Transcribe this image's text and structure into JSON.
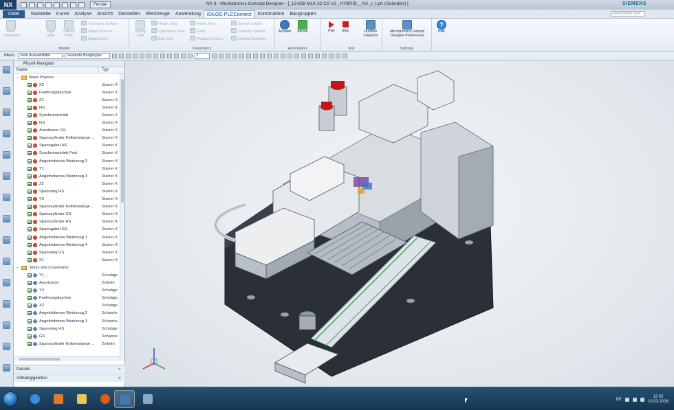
{
  "app": {
    "logo": "NX",
    "window_title": "NX 9 - Mechatronics Concept Designer - [_13-828 MLK 32 CS V2 _HYBRID__NX_v_t.prt (Geändert) ]",
    "fenster_label": "Fenster",
    "brand": "SIEMENS",
    "command_search_placeholder": "Einen Befehl such"
  },
  "ribbon_tabs": [
    "Datei",
    "Startseite",
    "Kurve",
    "Analyse",
    "Ansicht",
    "Darstellen",
    "Werkzeuge",
    "Anwendung",
    "iSILOG PLCConnect",
    "Konstruktion",
    "Baugruppen"
  ],
  "active_tab": "iSILOG PLCConnect",
  "ribbon": {
    "modell": {
      "label": "Modell",
      "buttons": [
        "Move Component",
        "Rigid Body",
        "Collision Body",
        "Sliding Joint"
      ],
      "small": [
        "Transport Surface",
        "Object Source",
        "Object Sink"
      ]
    },
    "kinematics": {
      "label": "Kinematics",
      "small": [
        "Hinge Joint",
        "Cylindrical Joint",
        "Ball Joint",
        "Fixed Joint",
        "Gear",
        "Position Control",
        "Speed Control",
        "Collision Sensor",
        "Limited Switches"
      ]
    },
    "automation": {
      "label": "Automation",
      "buttons": [
        "Actuator",
        "Sensor"
      ]
    },
    "test": {
      "label": "Test",
      "buttons": [
        "Play",
        "Stop",
        "Runtime Inspector"
      ]
    },
    "settings": {
      "label": "Settings",
      "buttons": [
        "Mechatronics Concept Designer Preferences"
      ]
    },
    "help": {
      "label": "Hilfe"
    }
  },
  "toolbar": {
    "menu_label": "Menü",
    "filter_value": "Kein Auswahlfilter",
    "scope_value": "Gesamte Baugruppe",
    "step_value": "1"
  },
  "navigator": {
    "title": "Physik-Navigator",
    "columns": [
      "Name",
      "Typ"
    ],
    "groups": [
      {
        "name": "Basic Physics",
        "items": [
          {
            "name": "X2",
            "type": "Starrer K"
          },
          {
            "name": "Fuehrungsbuchse",
            "type": "Starrer K"
          },
          {
            "name": "Z1",
            "type": "Starrer K"
          },
          {
            "name": "HS",
            "type": "Starrer K"
          },
          {
            "name": "Synchronantrieb",
            "type": "Starrer K"
          },
          {
            "name": "GS",
            "type": "Starrer K"
          },
          {
            "name": "Ausstosser GS",
            "type": "Starrer K"
          },
          {
            "name": "Spannzylinder Kolbenstange ...",
            "type": "Starrer K"
          },
          {
            "name": "Spanngabel HS",
            "type": "Starrer K"
          },
          {
            "name": "Synchronantrieb Fest",
            "type": "Starrer K"
          },
          {
            "name": "Angetriebenes Werkzeug 2",
            "type": "Starrer K"
          },
          {
            "name": "Y1",
            "type": "Starrer K"
          },
          {
            "name": "Angetriebenes Werkzeug 3",
            "type": "Starrer K"
          },
          {
            "name": "Z2",
            "type": "Starrer K"
          },
          {
            "name": "Spannring HS",
            "type": "Starrer K"
          },
          {
            "name": "Y2",
            "type": "Starrer K"
          },
          {
            "name": "Spannzylinder Kolbenstange ...",
            "type": "Starrer K"
          },
          {
            "name": "Spannzylinder GS",
            "type": "Starrer K"
          },
          {
            "name": "Spannzylinder HS",
            "type": "Starrer K"
          },
          {
            "name": "Spanngabel GS",
            "type": "Starrer K"
          },
          {
            "name": "Angetriebenes Werkzeug 1",
            "type": "Starrer K"
          },
          {
            "name": "Angetriebenes Werkzeug 4",
            "type": "Starrer K"
          },
          {
            "name": "Spannring GS",
            "type": "Starrer K"
          },
          {
            "name": "X1",
            "type": "Starrer K"
          }
        ]
      },
      {
        "name": "Joints and Constraints",
        "items": [
          {
            "name": "Y1",
            "type": "Schubge"
          },
          {
            "name": "Ausstosser",
            "type": "Zylindri"
          },
          {
            "name": "Y2",
            "type": "Schubge"
          },
          {
            "name": "Fuehrungsbuchse",
            "type": "Schubge"
          },
          {
            "name": "X2",
            "type": "Schubge"
          },
          {
            "name": "Angetriebenes Werkzeug 2",
            "type": "Scharnie"
          },
          {
            "name": "Angetriebenes Werkzeug 1",
            "type": "Scharnie"
          },
          {
            "name": "Spannring HS",
            "type": "Schubge"
          },
          {
            "name": "GS",
            "type": "Scharnie"
          },
          {
            "name": "Spannzylinder Kolbenstange ...",
            "type": "Zylindri"
          }
        ]
      }
    ],
    "panels": [
      "Details",
      "Abhängigkeiten"
    ]
  },
  "tray": {
    "language": "DE",
    "time": "12:02",
    "date": "10.03.2016"
  },
  "colors": {
    "file_tab": "#2a5b8e",
    "stop_red": "#cc1e1e",
    "taskbar": "#163651"
  }
}
